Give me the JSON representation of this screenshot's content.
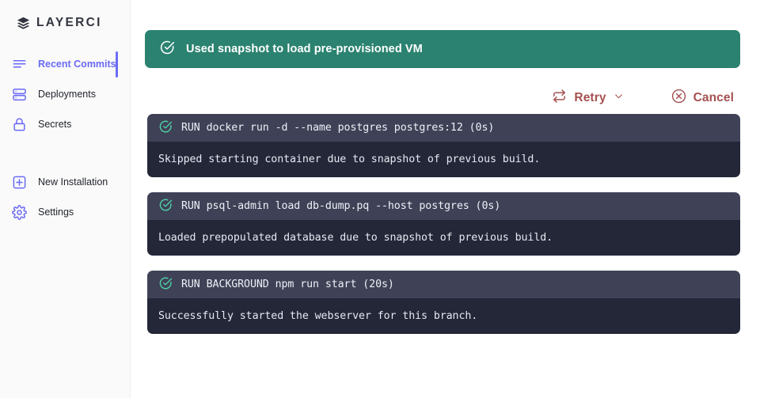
{
  "brand": {
    "name": "LAYERCI",
    "logo_icon": "layers-icon"
  },
  "sidebar": {
    "items": [
      {
        "label": "Recent Commits",
        "icon": "list-lines-icon",
        "active": true
      },
      {
        "label": "Deployments",
        "icon": "server-stack-icon",
        "active": false
      },
      {
        "label": "Secrets",
        "icon": "lock-icon",
        "active": false
      },
      {
        "label": "New Installation",
        "icon": "plus-square-icon",
        "active": false
      },
      {
        "label": "Settings",
        "icon": "gear-icon",
        "active": false
      }
    ]
  },
  "banner": {
    "text": "Used snapshot to load pre-provisioned VM",
    "icon": "check-circle-icon",
    "color": "#2b8270"
  },
  "actions": {
    "color": "#a55150",
    "retry": {
      "label": "Retry",
      "icon": "repeat-icon",
      "caret": "chevron-down-icon"
    },
    "cancel": {
      "label": "Cancel",
      "icon": "x-circle-icon"
    }
  },
  "blocks": [
    {
      "status_icon": "check-circle-icon",
      "command": "RUN docker run -d --name postgres postgres:12 (0s)",
      "output": "Skipped starting container due to snapshot of previous build."
    },
    {
      "status_icon": "check-circle-icon",
      "command": "RUN psql-admin load db-dump.pq --host postgres (0s)",
      "output": "Loaded prepopulated database due to snapshot of previous build."
    },
    {
      "status_icon": "check-circle-icon",
      "command": "RUN BACKGROUND npm run start (20s)",
      "output": "Successfully started the webserver for this branch."
    }
  ]
}
